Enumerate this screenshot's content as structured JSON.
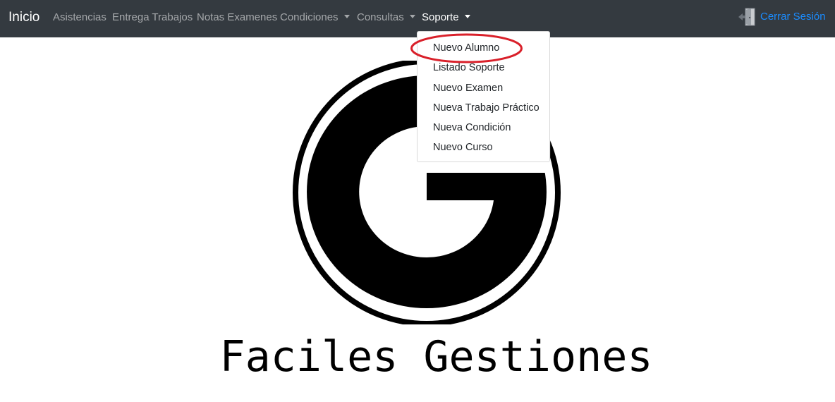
{
  "navbar": {
    "brand": "Inicio",
    "items": [
      {
        "label": "Asistencias"
      },
      {
        "label": "Entrega Trabajos"
      },
      {
        "label": "Notas Examenes"
      },
      {
        "label": "Condiciones"
      },
      {
        "label": "Consultas"
      },
      {
        "label": "Soporte"
      }
    ],
    "logout_label": "Cerrar Sesión",
    "logout_icon": "logout-door-icon"
  },
  "soporte_menu": {
    "items": [
      {
        "label": "Nuevo Alumno"
      },
      {
        "label": "Listado Soporte"
      },
      {
        "label": "Nuevo Examen"
      },
      {
        "label": "Nueva Trabajo Práctico"
      },
      {
        "label": "Nueva Condición"
      },
      {
        "label": "Nuevo Curso"
      }
    ],
    "highlighted_item": "Nuevo Alumno"
  },
  "main": {
    "logo_text": "Faciles Gestiones"
  },
  "colors": {
    "navbar_bg": "#343a40",
    "link": "#1a8cff",
    "highlight_ring": "#d9202a"
  }
}
